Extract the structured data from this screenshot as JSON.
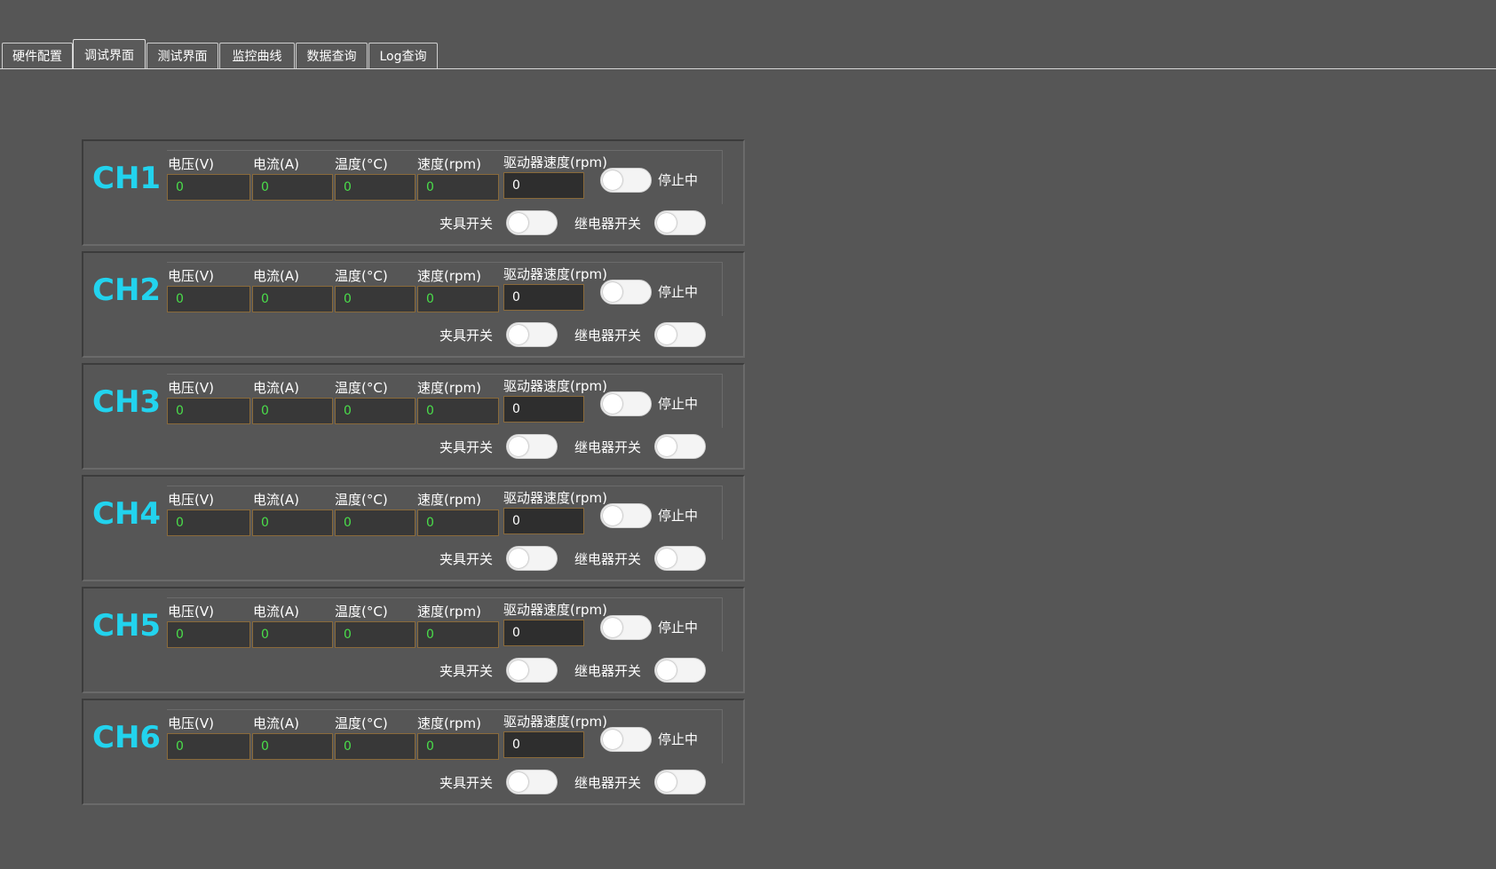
{
  "tabs": [
    {
      "label": "硬件配置"
    },
    {
      "label": "调试界面"
    },
    {
      "label": "测试界面"
    },
    {
      "label": "监控曲线"
    },
    {
      "label": "数据查询"
    },
    {
      "label": "Log查询"
    }
  ],
  "active_tab": "调试界面",
  "field_labels": {
    "voltage": "电压(V)",
    "current": "电流(A)",
    "temperature": "温度(°C)",
    "speed": "速度(rpm)",
    "driver_speed": "驱动器速度(rpm)",
    "run_state": "停止中",
    "clamp_switch": "夹具开关",
    "relay_switch": "继电器开关"
  },
  "channels": [
    {
      "name": "CH1",
      "voltage": "0",
      "current": "0",
      "temperature": "0",
      "speed": "0",
      "driver_speed": "0",
      "run_on": false,
      "clamp_on": false,
      "relay_on": false
    },
    {
      "name": "CH2",
      "voltage": "0",
      "current": "0",
      "temperature": "0",
      "speed": "0",
      "driver_speed": "0",
      "run_on": false,
      "clamp_on": false,
      "relay_on": false
    },
    {
      "name": "CH3",
      "voltage": "0",
      "current": "0",
      "temperature": "0",
      "speed": "0",
      "driver_speed": "0",
      "run_on": false,
      "clamp_on": false,
      "relay_on": false
    },
    {
      "name": "CH4",
      "voltage": "0",
      "current": "0",
      "temperature": "0",
      "speed": "0",
      "driver_speed": "0",
      "run_on": false,
      "clamp_on": false,
      "relay_on": false
    },
    {
      "name": "CH5",
      "voltage": "0",
      "current": "0",
      "temperature": "0",
      "speed": "0",
      "driver_speed": "0",
      "run_on": false,
      "clamp_on": false,
      "relay_on": false
    },
    {
      "name": "CH6",
      "voltage": "0",
      "current": "0",
      "temperature": "0",
      "speed": "0",
      "driver_speed": "0",
      "run_on": false,
      "clamp_on": false,
      "relay_on": false
    }
  ],
  "colors": {
    "background": "#565656",
    "channel_title": "#22d3ee",
    "reading_value": "#4ade4a",
    "input_border": "#8a6a3a"
  }
}
